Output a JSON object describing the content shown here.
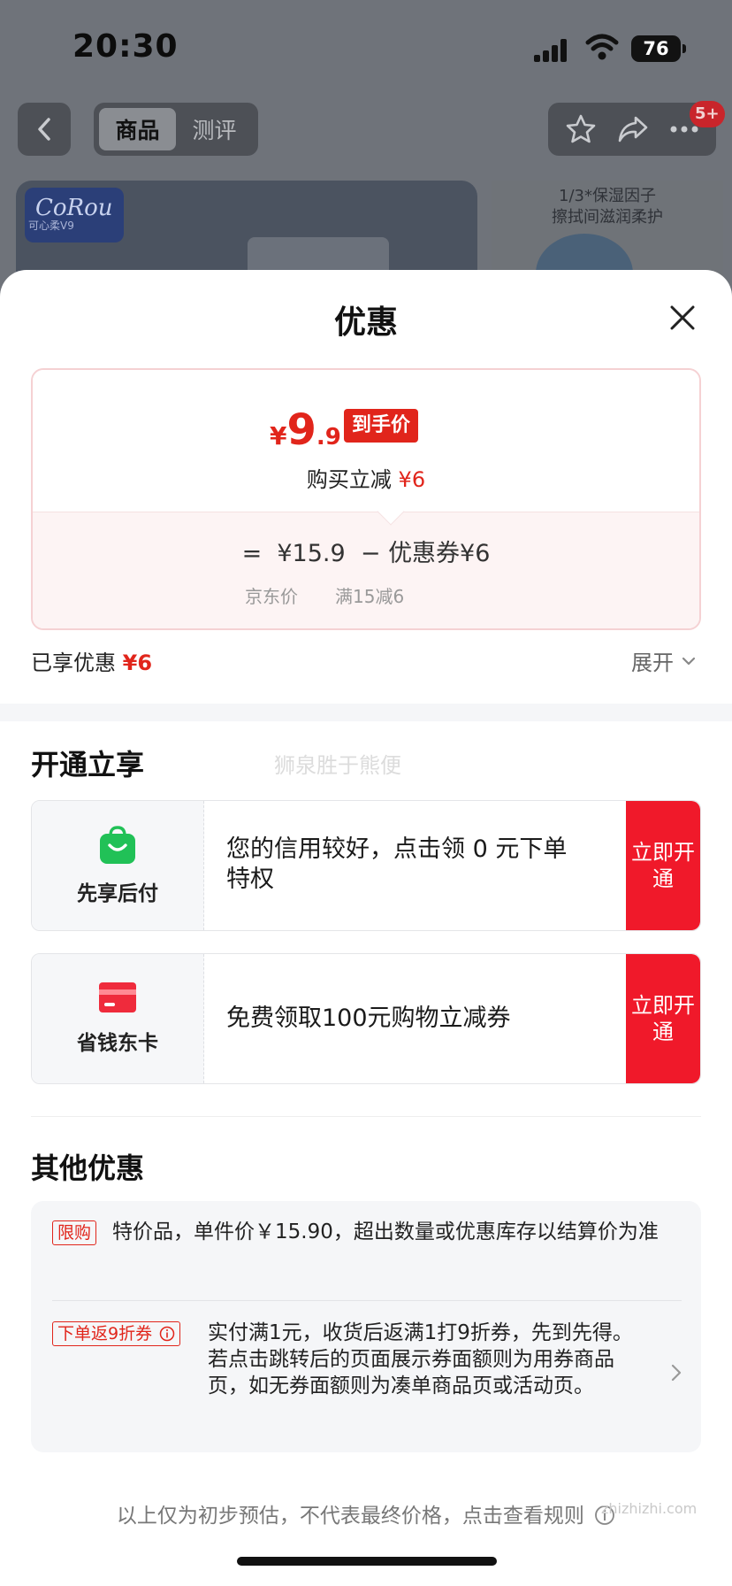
{
  "status_bar": {
    "time": "20:30",
    "battery": "76"
  },
  "header": {
    "tabs": [
      {
        "label": "商品",
        "active": true
      },
      {
        "label": "测评",
        "active": false
      }
    ],
    "badge": "5+"
  },
  "background": {
    "brand": "CoRou",
    "brand_sub": "可心柔V9",
    "promo_line1": "1/3*保湿因子",
    "promo_line2": "擦拭间滋润柔护"
  },
  "sheet": {
    "title": "优惠",
    "price_card": {
      "currency": "¥",
      "price_int": "9",
      "price_dec": ".9",
      "final_tag": "到手价",
      "instant_cut_label": "购买立减",
      "instant_cut_value": "¥6",
      "calc_equals": "=",
      "jd_price": "¥15.9",
      "minus": "−",
      "coupon": "优惠券¥6",
      "jd_price_label": "京东价",
      "coupon_rule": "满15减6"
    },
    "enjoyed_label": "已享优惠",
    "enjoyed_value": "¥6",
    "expand_label": "展开",
    "section_open": "开通立享",
    "watermark": "狮泉胜于熊便",
    "offers": [
      {
        "label": "先享后付",
        "text": "您的信用较好，点击领 0 元下单特权",
        "btn": "立即开通",
        "icon": "shopping-bag-icon",
        "color": "#21c157"
      },
      {
        "label": "省钱东卡",
        "text": "免费领取100元购物立减券",
        "btn": "立即开通",
        "icon": "card-icon",
        "color": "#ef2b3c"
      }
    ],
    "section_other": "其他优惠",
    "other": [
      {
        "tag": "限购",
        "text": "特价品，单件价￥15.90，超出数量或优惠库存以结算价为准"
      },
      {
        "tag": "下单返9折券",
        "text": "实付满1元，收货后返满1打9折券，先到先得。若点击跳转后的页面展示券面额则为用券商品页，如无券面额则为凑单商品页或活动页。"
      }
    ],
    "footer_note": "以上仅为初步预估，不代表最终价格，点击查看规则",
    "site_watermark": "zhizhizhi.com"
  }
}
